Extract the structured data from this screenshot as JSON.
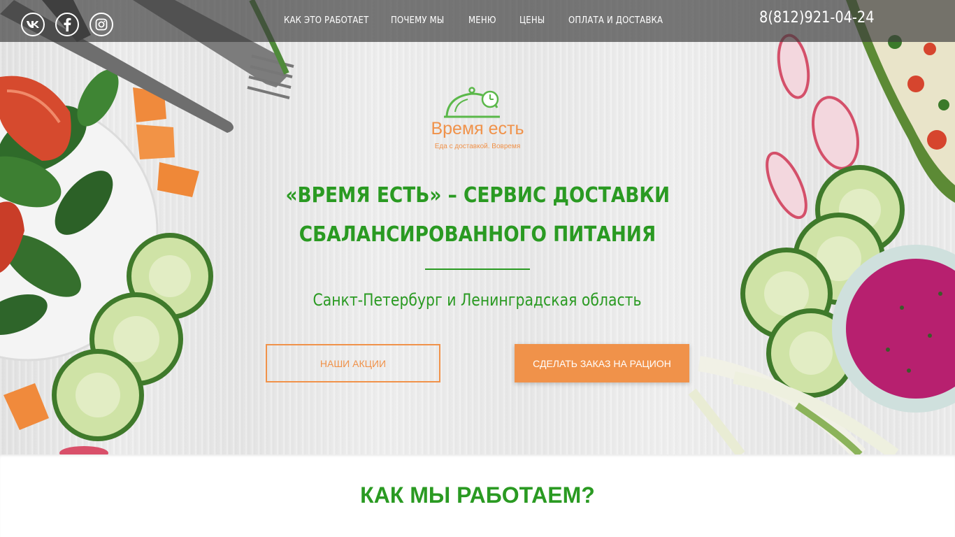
{
  "social": [
    {
      "name": "vk-icon",
      "label": "VK"
    },
    {
      "name": "facebook-icon",
      "label": "f"
    },
    {
      "name": "instagram-icon",
      "label": ""
    }
  ],
  "nav": {
    "items": [
      {
        "label": "КАК ЭТО РАБОТАЕТ"
      },
      {
        "label": "ПОЧЕМУ МЫ"
      },
      {
        "label": "МЕНЮ"
      },
      {
        "label": "ЦЕНЫ"
      },
      {
        "label": "ОПЛАТА И ДОСТАВКА"
      }
    ]
  },
  "phone": "8(812)921-04-24",
  "logo": {
    "name": "Время есть",
    "tagline": "Еда с доставкой. Вовремя",
    "icon": "cloche-clock-icon"
  },
  "hero": {
    "headline_line1": "«ВРЕМЯ ЕСТЬ» – СЕРВИС ДОСТАВКИ",
    "headline_line2": "СБАЛАНСИРОВАННОГО ПИТАНИЯ",
    "region": "Санкт-Петербург и Ленинградская область",
    "promo_button": "НАШИ АКЦИИ",
    "order_button": "СДЕЛАТЬ ЗАКАЗ НА РАЦИОН"
  },
  "section": {
    "title": "КАК МЫ РАБОТАЕМ?"
  },
  "colors": {
    "green": "#2a9a22",
    "orange": "#f0924a",
    "topbar": "#3c3c3c"
  }
}
